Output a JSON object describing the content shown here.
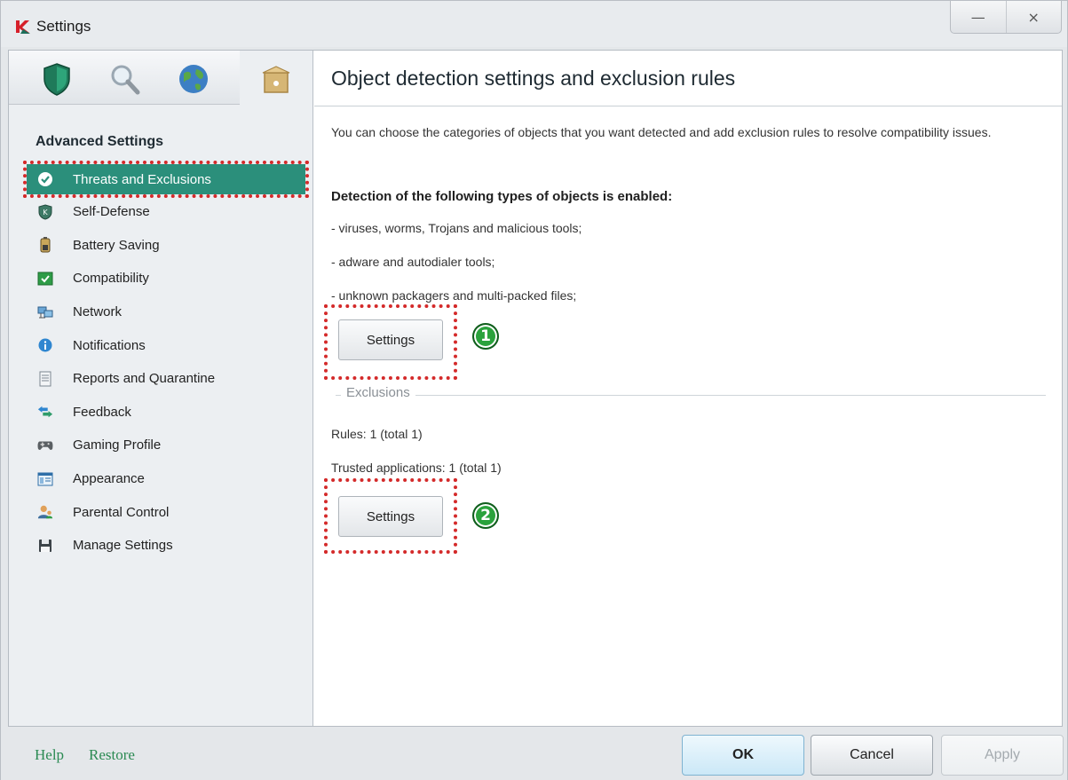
{
  "window": {
    "title": "Settings",
    "minimize_glyph": "—",
    "close_glyph": "×"
  },
  "sidebar": {
    "heading": "Advanced Settings",
    "top_tabs": [
      {
        "icon": "shield-icon"
      },
      {
        "icon": "magnifier-icon"
      },
      {
        "icon": "globe-icon"
      },
      {
        "icon": "briefcase-icon",
        "active": true
      }
    ],
    "items": [
      {
        "label": "Threats and Exclusions",
        "icon": "checkmark-icon",
        "active": true
      },
      {
        "label": "Self-Defense",
        "icon": "kaspersky-shield-icon"
      },
      {
        "label": "Battery Saving",
        "icon": "battery-icon"
      },
      {
        "label": "Compatibility",
        "icon": "compatibility-check-icon"
      },
      {
        "label": "Network",
        "icon": "network-computers-icon"
      },
      {
        "label": "Notifications",
        "icon": "info-icon"
      },
      {
        "label": "Reports and Quarantine",
        "icon": "report-document-icon"
      },
      {
        "label": "Feedback",
        "icon": "feedback-arrows-icon"
      },
      {
        "label": "Gaming Profile",
        "icon": "gamepad-icon"
      },
      {
        "label": "Appearance",
        "icon": "appearance-window-icon"
      },
      {
        "label": "Parental Control",
        "icon": "parental-control-icon"
      },
      {
        "label": "Manage Settings",
        "icon": "floppy-disk-icon"
      }
    ]
  },
  "main": {
    "title": "Object detection settings and exclusion rules",
    "description": "You can choose the categories of objects that you want detected and add exclusion rules to resolve compatibility issues.",
    "detection_heading": "Detection of the following types of objects is enabled:",
    "detection_items": [
      "- viruses, worms, Trojans and malicious tools;",
      "- adware and autodialer tools;",
      "- unknown packagers and multi-packed files;"
    ],
    "detection_settings_button": "Settings",
    "badge_1": "1",
    "exclusions_label": "Exclusions",
    "rules_text": "Rules: 1 (total 1)",
    "trusted_text": "Trusted applications: 1 (total 1)",
    "exclusions_settings_button": "Settings",
    "badge_2": "2"
  },
  "footer": {
    "help_link": "Help",
    "restore_link": "Restore",
    "ok_button": "OK",
    "cancel_button": "Cancel",
    "apply_button": "Apply"
  },
  "colors": {
    "active_item_bg": "#2b8f7b",
    "highlight_dotted": "#d42a2a",
    "badge_green": "#2aa23c",
    "link_green": "#2a8a52"
  }
}
